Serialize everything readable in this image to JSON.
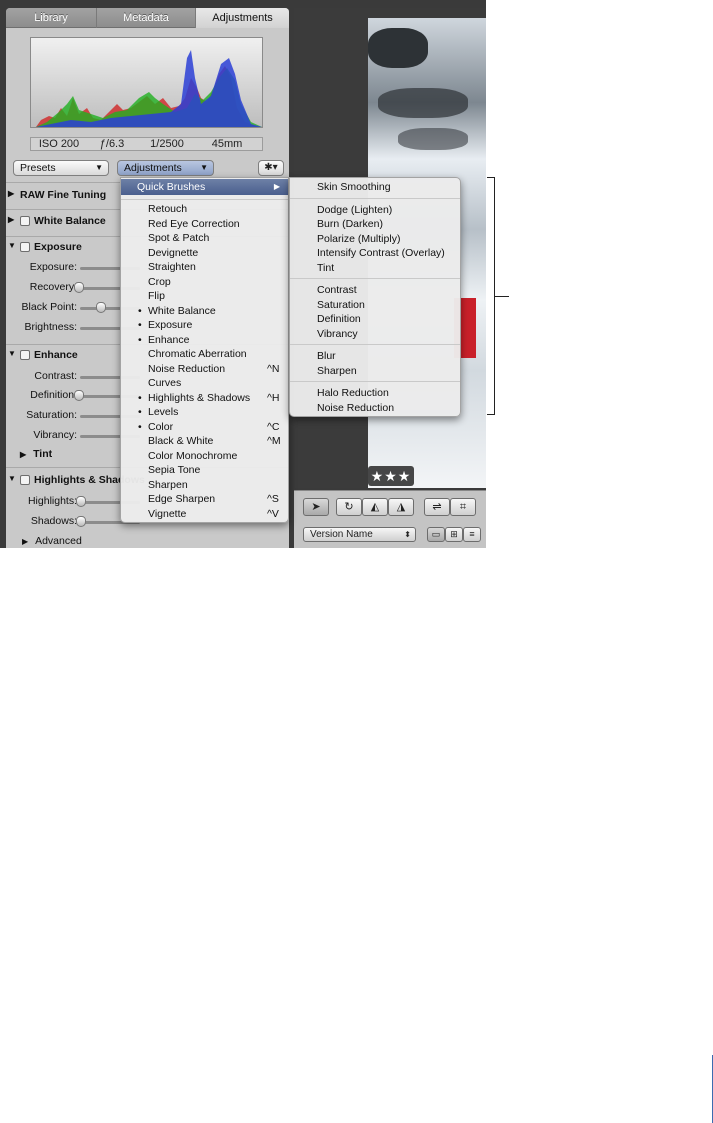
{
  "tabs": [
    {
      "label": "Library"
    },
    {
      "label": "Metadata"
    },
    {
      "label": "Adjustments"
    }
  ],
  "exif": {
    "iso": "ISO 200",
    "aperture": "ƒ/6.3",
    "shutter": "1/2500",
    "focal": "45mm"
  },
  "popups": {
    "presets": "Presets",
    "adjustments": "Adjustments",
    "gear": "✱▾"
  },
  "bricks": {
    "raw": "RAW Fine Tuning",
    "white_balance": "White Balance",
    "exposure": "Exposure",
    "enhance": "Enhance",
    "highlights": "Highlights & Shadows"
  },
  "exposure_sliders": [
    {
      "label": "Exposure:",
      "knob": null
    },
    {
      "label": "Recovery:",
      "knob": 0.0
    },
    {
      "label": "Black Point:",
      "knob": 0.33
    },
    {
      "label": "Brightness:",
      "knob": null
    }
  ],
  "enhance_sliders": [
    {
      "label": "Contrast:",
      "knob": null
    },
    {
      "label": "Definition:",
      "knob": 0.0
    },
    {
      "label": "Saturation:",
      "knob": null
    },
    {
      "label": "Vibrancy:",
      "knob": null
    }
  ],
  "tint_label": "Tint",
  "highlight_sliders": [
    {
      "label": "Highlights:",
      "knob": 0.0
    },
    {
      "label": "Shadows:",
      "knob": 0.0
    }
  ],
  "advanced_label": "Advanced",
  "main_menu": {
    "quick_brushes": "Quick Brushes",
    "items": [
      {
        "label": "Retouch",
        "bullet": false,
        "shortcut": ""
      },
      {
        "label": "Red Eye Correction",
        "bullet": false,
        "shortcut": ""
      },
      {
        "label": "Spot & Patch",
        "bullet": false,
        "shortcut": ""
      },
      {
        "label": "Devignette",
        "bullet": false,
        "shortcut": ""
      },
      {
        "label": "Straighten",
        "bullet": false,
        "shortcut": ""
      },
      {
        "label": "Crop",
        "bullet": false,
        "shortcut": ""
      },
      {
        "label": "Flip",
        "bullet": false,
        "shortcut": ""
      },
      {
        "label": "White Balance",
        "bullet": true,
        "shortcut": ""
      },
      {
        "label": "Exposure",
        "bullet": true,
        "shortcut": ""
      },
      {
        "label": "Enhance",
        "bullet": true,
        "shortcut": ""
      },
      {
        "label": "Chromatic Aberration",
        "bullet": false,
        "shortcut": ""
      },
      {
        "label": "Noise Reduction",
        "bullet": false,
        "shortcut": "^N"
      },
      {
        "label": "Curves",
        "bullet": false,
        "shortcut": ""
      },
      {
        "label": "Highlights & Shadows",
        "bullet": true,
        "shortcut": "^H"
      },
      {
        "label": "Levels",
        "bullet": true,
        "shortcut": ""
      },
      {
        "label": "Color",
        "bullet": true,
        "shortcut": "^C"
      },
      {
        "label": "Black & White",
        "bullet": false,
        "shortcut": "^M"
      },
      {
        "label": "Color Monochrome",
        "bullet": false,
        "shortcut": ""
      },
      {
        "label": "Sepia Tone",
        "bullet": false,
        "shortcut": ""
      },
      {
        "label": "Sharpen",
        "bullet": false,
        "shortcut": ""
      },
      {
        "label": "Edge Sharpen",
        "bullet": false,
        "shortcut": "^S"
      },
      {
        "label": "Vignette",
        "bullet": false,
        "shortcut": "^V"
      }
    ]
  },
  "sub_menu": {
    "groups": [
      [
        "Skin Smoothing"
      ],
      [
        "Dodge (Lighten)",
        "Burn (Darken)",
        "Polarize (Multiply)",
        "Intensify Contrast (Overlay)",
        "Tint"
      ],
      [
        "Contrast",
        "Saturation",
        "Definition",
        "Vibrancy"
      ],
      [
        "Blur",
        "Sharpen"
      ],
      [
        "Halo Reduction",
        "Noise Reduction"
      ]
    ]
  },
  "viewer": {
    "rating": "★★★",
    "version_popup": "Version Name"
  },
  "colors": {
    "inspector_bg": "#c9c9c9",
    "menu_highlight": "#4a5f8e",
    "viewer_bg": "#3b3b3b"
  }
}
